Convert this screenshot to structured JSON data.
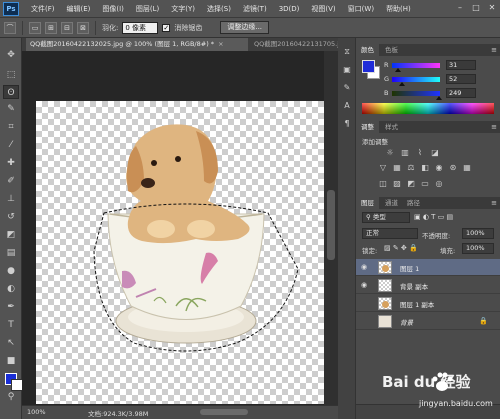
{
  "app": {
    "logo": "Ps"
  },
  "menu": [
    "文件(F)",
    "编辑(E)",
    "图像(I)",
    "图层(L)",
    "文字(Y)",
    "选择(S)",
    "滤镜(T)",
    "3D(D)",
    "视图(V)",
    "窗口(W)",
    "帮助(H)"
  ],
  "window_controls": [
    "–",
    "□",
    "✕"
  ],
  "options": {
    "feather_label": "羽化:",
    "feather_value": "0 像素",
    "antialias_label": "消除锯齿",
    "antialias_checked": true,
    "refine_button": "调整边缘..."
  },
  "documents": [
    {
      "title": "QQ截图20160422132025.jpg @ 100% (图层 1, RGB/8#) *",
      "active": true
    },
    {
      "title": "QQ截图20160422131705.jpg",
      "active": false
    }
  ],
  "status": {
    "zoom": "100%",
    "doc_size": "文档:924.3K/3.98M"
  },
  "color_panel": {
    "tabs": [
      "颜色",
      "色板"
    ],
    "foreground": "#1f2cd8",
    "background": "#ffffff",
    "channels": [
      {
        "label": "R",
        "value": "31",
        "level": 0.12
      },
      {
        "label": "G",
        "value": "52",
        "level": 0.2
      },
      {
        "label": "B",
        "value": "249",
        "level": 0.98
      }
    ]
  },
  "adjust_panel": {
    "tabs": [
      "调整",
      "样式"
    ],
    "title": "添加调整",
    "icons_row1": [
      "brightness-icon",
      "levels-icon",
      "curves-icon",
      "exposure-icon"
    ],
    "icons_row2": [
      "vibrance-icon",
      "hue-saturation-icon",
      "color-balance-icon",
      "black-white-icon",
      "photo-filter-icon",
      "channel-mixer-icon",
      "color-lookup-icon"
    ],
    "icons_row3": [
      "invert-icon",
      "posterize-icon",
      "threshold-icon",
      "gradient-map-icon",
      "selective-color-icon"
    ]
  },
  "layers_panel": {
    "tabs": [
      "图层",
      "通道",
      "路径"
    ],
    "kind_filter": "类型",
    "blend_mode": "正常",
    "opacity_label": "不透明度:",
    "opacity_value": "100%",
    "lock_label": "锁定:",
    "fill_label": "填充:",
    "fill_value": "100%",
    "layers": [
      {
        "name": "图层 1",
        "visible": true,
        "selected": true,
        "italic": false,
        "locked": false,
        "thumb": "dog"
      },
      {
        "name": "背景 副本",
        "visible": true,
        "selected": false,
        "italic": false,
        "locked": false,
        "thumb": "photo"
      },
      {
        "name": "图层 1 副本",
        "visible": false,
        "selected": false,
        "italic": false,
        "locked": false,
        "thumb": "dog"
      },
      {
        "name": "背景",
        "visible": false,
        "selected": false,
        "italic": true,
        "locked": true,
        "thumb": "bg"
      }
    ]
  },
  "watermark": {
    "brand": "Bai du 经验",
    "url": "jingyan.baidu.com"
  }
}
